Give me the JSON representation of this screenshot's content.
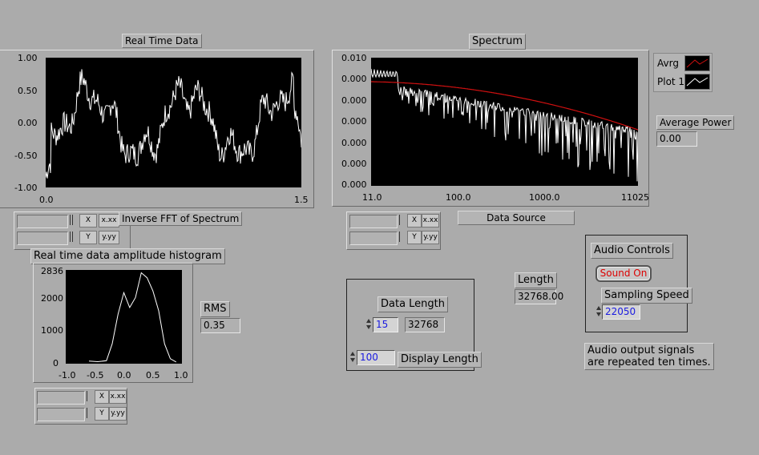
{
  "real_time": {
    "title": "Real Time Data",
    "y_ticks": [
      "1.00",
      "0.50",
      "0.00",
      "-0.50",
      "-1.00"
    ],
    "x_ticks": [
      "0.0",
      "1.5"
    ],
    "inverse_fft_label": "Inverse FFT of Spectrum"
  },
  "spectrum": {
    "title": "Spectrum",
    "y_ticks": [
      "0.010",
      "0.000",
      "0.000",
      "0.000",
      "0.000",
      "0.000",
      "0.000"
    ],
    "x_ticks": [
      "11.0",
      "100.0",
      "1000.0",
      "11025.0"
    ],
    "legend": [
      {
        "name": "Avrg",
        "color": "#d01010"
      },
      {
        "name": "Plot 1",
        "color": "#ffffff"
      }
    ],
    "average_power_label": "Average Power",
    "average_power_value": "0.00",
    "data_source_label": "Data Source"
  },
  "histogram": {
    "title": "Real time data amplitude histogram",
    "y_ticks": [
      "2836",
      "2000",
      "1000",
      "0"
    ],
    "x_ticks": [
      "-1.0",
      "-0.5",
      "0.0",
      "0.5",
      "1.0"
    ],
    "rms_label": "RMS",
    "rms_value": "0.35"
  },
  "data_length": {
    "label": "Data Length",
    "control_value": "15",
    "indicator_value": "32768",
    "display_length_value": "100",
    "display_length_label": "Display Length"
  },
  "length": {
    "label": "Length",
    "value": "32768.00"
  },
  "audio": {
    "title": "Audio Controls",
    "sound_button": "Sound On",
    "sampling_label": "Sampling Speed",
    "sampling_value": "22050",
    "note": "Audio output signals\nare repeated ten times."
  },
  "scale_legend": {
    "x_button": "X",
    "y_button": "Y",
    "x_format": "x.xx",
    "y_format": "y.yy"
  },
  "colors": {
    "panel": "#ababab",
    "plot_bg": "#000000",
    "trace": "#ffffff",
    "avg_trace": "#d01010",
    "control_text": "#1a1ae0",
    "button_text": "#dd0000"
  }
}
